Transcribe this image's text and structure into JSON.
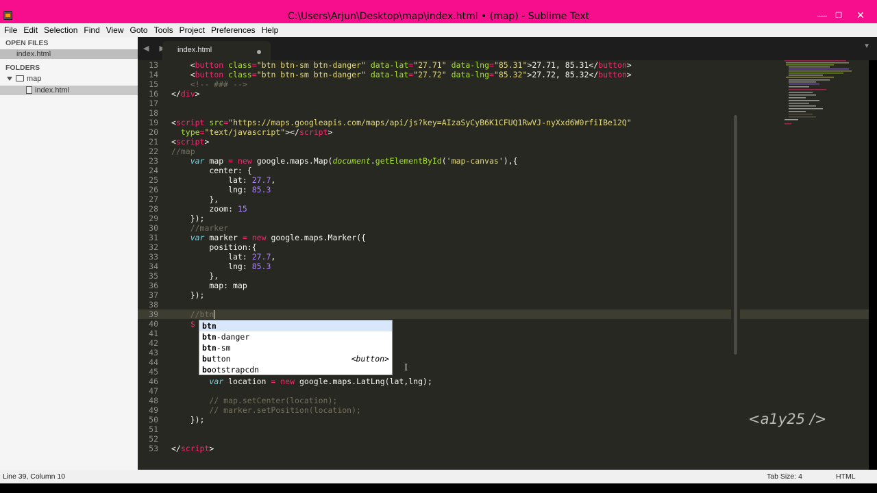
{
  "window": {
    "title": "C:\\Users\\Arjun\\Desktop\\map\\index.html • (map) - Sublime Text",
    "minimize": "—",
    "maximize": "❐",
    "close": "✕"
  },
  "menu": [
    "File",
    "Edit",
    "Selection",
    "Find",
    "View",
    "Goto",
    "Tools",
    "Project",
    "Preferences",
    "Help"
  ],
  "sidebar": {
    "open_files_header": "OPEN FILES",
    "open_files": [
      "index.html"
    ],
    "folders_header": "FOLDERS",
    "folder_name": "map",
    "folder_files": [
      "index.html"
    ]
  },
  "tab": {
    "nav": "◀ ▶",
    "label": "index.html",
    "dropdown": "▼"
  },
  "editor": {
    "active_line": 39,
    "lines": [
      {
        "n": "13"
      },
      {
        "n": "14"
      },
      {
        "n": "15"
      },
      {
        "n": "16"
      },
      {
        "n": "17"
      },
      {
        "n": "18"
      },
      {
        "n": "19"
      },
      {
        "n": "20"
      },
      {
        "n": "21"
      },
      {
        "n": "22"
      },
      {
        "n": "23"
      },
      {
        "n": "24"
      },
      {
        "n": "25"
      },
      {
        "n": "26"
      },
      {
        "n": "27"
      },
      {
        "n": "28"
      },
      {
        "n": "29"
      },
      {
        "n": "30"
      },
      {
        "n": "31"
      },
      {
        "n": "32"
      },
      {
        "n": "33"
      },
      {
        "n": "34"
      },
      {
        "n": "35"
      },
      {
        "n": "36"
      },
      {
        "n": "37"
      },
      {
        "n": "38"
      },
      {
        "n": "39"
      },
      {
        "n": "40"
      },
      {
        "n": "41"
      },
      {
        "n": "42"
      },
      {
        "n": "43"
      },
      {
        "n": "44"
      },
      {
        "n": "45"
      },
      {
        "n": "46"
      },
      {
        "n": "47"
      },
      {
        "n": "48"
      },
      {
        "n": "49"
      },
      {
        "n": "50"
      },
      {
        "n": "51"
      },
      {
        "n": "52"
      },
      {
        "n": "53"
      }
    ],
    "code": {
      "l13": [
        "    <",
        "button",
        " ",
        "class",
        "=",
        "\"btn btn-sm btn-danger\"",
        " ",
        "data-lat",
        "=",
        "\"27.71\"",
        " ",
        "data-lng",
        "=",
        "\"85.31\"",
        ">27.71, 85.31</",
        "button",
        ">"
      ],
      "l14": [
        "    <",
        "button",
        " ",
        "class",
        "=",
        "\"btn btn-sm btn-danger\"",
        " ",
        "data-lat",
        "=",
        "\"27.72\"",
        " ",
        "data-lng",
        "=",
        "\"85.32\"",
        ">27.72, 85.32</",
        "button",
        ">"
      ],
      "l15": "    <!-- ### -->",
      "l16": [
        "</",
        "div",
        ">"
      ],
      "l19": [
        "<",
        "script",
        " ",
        "src",
        "=",
        "\"https://maps.googleapis.com/maps/api/js?key=AIzaSyCyB6K1CFUQ1RwVJ-nyXxd6W0rfiIBe12Q\""
      ],
      "l20": [
        "  ",
        "type",
        "=",
        "\"text/javascript\"",
        "></",
        "script",
        ">"
      ],
      "l21": [
        "<",
        "script",
        ">"
      ],
      "l22": "//map",
      "l23": [
        "    ",
        "var",
        " map ",
        "=",
        " ",
        "new",
        " google.maps.Map(",
        "document",
        ".",
        "getElementById",
        "(",
        "'map-canvas'",
        "),{"
      ],
      "l24": "        center: {",
      "l25": [
        "            lat: ",
        "27.7",
        ","
      ],
      "l26": [
        "            lng: ",
        "85.3"
      ],
      "l27": "        },",
      "l28": [
        "        zoom: ",
        "15"
      ],
      "l29": "    });",
      "l30": "    //marker",
      "l31": [
        "    ",
        "var",
        " marker ",
        "=",
        " ",
        "new",
        " google.maps.Marker({"
      ],
      "l32": "        position:{",
      "l33": [
        "            lat: ",
        "27.7",
        ","
      ],
      "l34": [
        "            lng: ",
        "85.3"
      ],
      "l35": "        },",
      "l36": "        map: map",
      "l37": "    });",
      "l39": "    //btn",
      "l40": [
        "    ",
        "$"
      ],
      "l46": [
        "        ",
        "var",
        " location ",
        "=",
        " ",
        "new",
        " google.maps.LatLng(lat,lng);"
      ],
      "l48": "        // map.setCenter(location);",
      "l49": "        // marker.setPosition(location);",
      "l50": "    });",
      "l53": [
        "</",
        "script",
        ">"
      ]
    }
  },
  "autocomplete": {
    "items": [
      {
        "typed": "btn",
        "rest": "",
        "hint": ""
      },
      {
        "typed": "btn",
        "rest": "-danger",
        "hint": ""
      },
      {
        "typed": "btn",
        "rest": "-sm",
        "hint": ""
      },
      {
        "typed": "bu",
        "rest": "tton",
        "hint": "<button>"
      },
      {
        "typed": "bo",
        "rest": "otstrapcdn",
        "hint": ""
      }
    ]
  },
  "watermark": "<a1y25 />",
  "status": {
    "position": "Line 39, Column 10",
    "tab_size": "Tab Size: 4",
    "syntax": "HTML"
  },
  "colors": {
    "titlebar": "#f70e8c",
    "editor_bg": "#272822",
    "tag": "#f92672",
    "attr": "#a6e22e",
    "string": "#e6db74",
    "number": "#ae81ff",
    "keyword": "#66d9ef",
    "comment": "#75715e"
  }
}
